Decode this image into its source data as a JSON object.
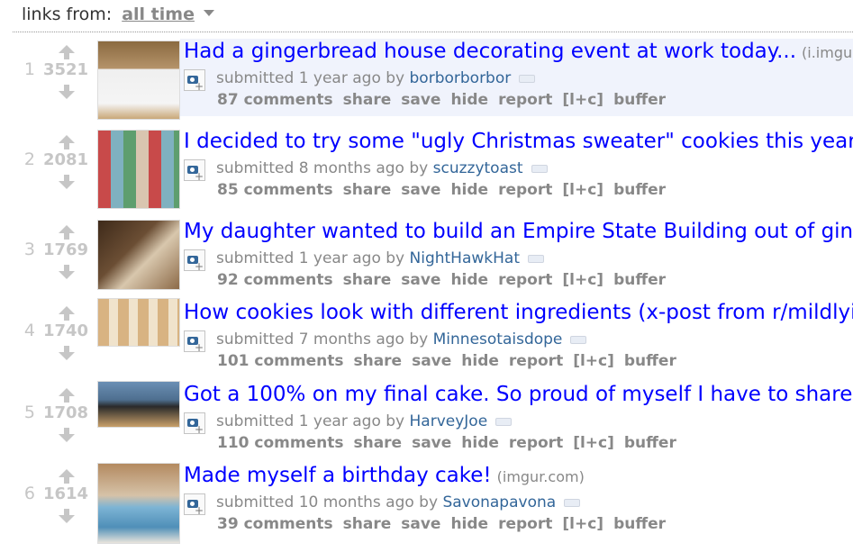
{
  "filter": {
    "label": "links from:",
    "value": "all time"
  },
  "posts": [
    {
      "rank": "1",
      "score": "3521",
      "title": "Had a gingerbread house decorating event at work today...",
      "domain": "(i.imgu",
      "submitted": "submitted 1 year ago by",
      "author": "borborborbor",
      "comments": "87 comments",
      "highlight": true
    },
    {
      "rank": "2",
      "score": "2081",
      "title": "I decided to try some \"ugly Christmas sweater\" cookies this year.",
      "domain": "",
      "submitted": "submitted 8 months ago by",
      "author": "scuzzytoast",
      "comments": "85 comments",
      "highlight": false
    },
    {
      "rank": "3",
      "score": "1769",
      "title": "My daughter wanted to build an Empire State Building out of ging",
      "domain": "",
      "submitted": "submitted 1 year ago by",
      "author": "NightHawkHat",
      "comments": "92 comments",
      "highlight": false
    },
    {
      "rank": "4",
      "score": "1740",
      "title": "How cookies look with different ingredients (x-post from r/mildlyi",
      "domain": "",
      "submitted": "submitted 7 months ago by",
      "author": "Minnesotaisdope",
      "comments": "101 comments",
      "highlight": false
    },
    {
      "rank": "5",
      "score": "1708",
      "title": "Got a 100% on my final cake. So proud of myself I have to share",
      "domain": "",
      "submitted": "submitted 1 year ago by",
      "author": "HarveyJoe",
      "comments": "110 comments",
      "highlight": false
    },
    {
      "rank": "6",
      "score": "1614",
      "title": "Made myself a birthday cake!",
      "domain": "(imgur.com)",
      "submitted": "submitted 10 months ago by",
      "author": "Savonapavona",
      "comments": "39 comments",
      "highlight": false
    }
  ],
  "actions": {
    "share": "share",
    "save": "save",
    "hide": "hide",
    "report": "report",
    "lc": "[l+c]",
    "buffer": "buffer"
  },
  "icons": {
    "upvote": "upvote-arrow-icon",
    "downvote": "downvote-arrow-icon",
    "expando": "image-expando-icon",
    "tag": "flair-tag-icon"
  },
  "colors": {
    "title_link": "#0000ff",
    "author_link": "#336699",
    "muted": "#888888",
    "vote_gray": "#c6c6c6",
    "highlight_bg": "#f0f3fc"
  }
}
